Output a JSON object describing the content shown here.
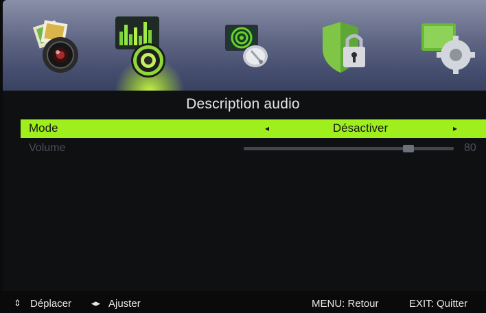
{
  "menu": {
    "icons": [
      {
        "name": "picture-icon"
      },
      {
        "name": "sound-icon",
        "active": true
      },
      {
        "name": "channel-icon"
      },
      {
        "name": "lock-icon"
      },
      {
        "name": "setup-icon"
      }
    ]
  },
  "page": {
    "title": "Description audio"
  },
  "options": {
    "mode": {
      "label": "Mode",
      "value": "Désactiver",
      "left_arrow": "◂",
      "right_arrow": "▸"
    },
    "volume": {
      "label": "Volume",
      "value": "80",
      "level": 0.8
    }
  },
  "footer": {
    "move_icon": "⇕",
    "move_label": "Déplacer",
    "adjust_icon": "◂▸",
    "adjust_label": "Ajuster",
    "menu_hint": "MENU: Retour",
    "exit_hint": "EXIT: Quitter"
  },
  "colors": {
    "accent": "#9fef1d",
    "band_top": "#8a90a8",
    "band_bottom": "#3a4262",
    "background": "#0f1012"
  }
}
